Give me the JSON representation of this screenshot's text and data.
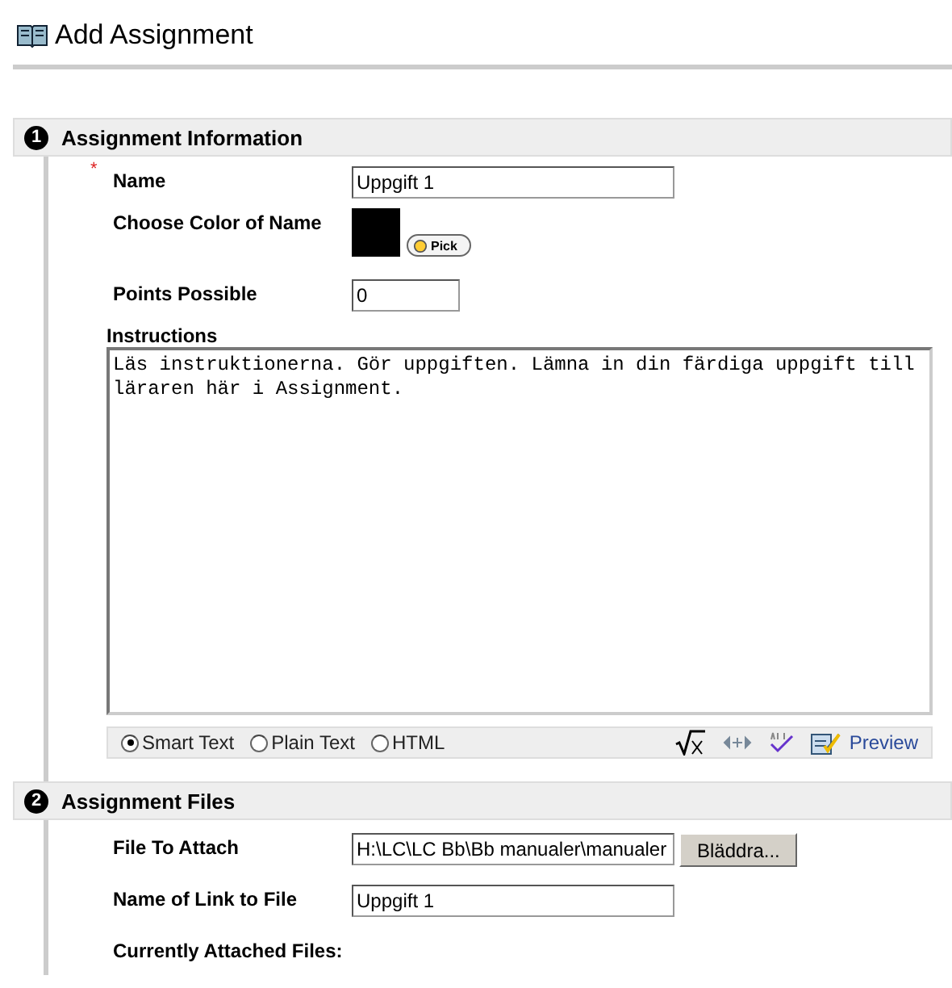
{
  "page": {
    "title": "Add Assignment"
  },
  "sections": [
    {
      "number": "1",
      "title": "Assignment Information"
    },
    {
      "number": "2",
      "title": "Assignment Files"
    }
  ],
  "info": {
    "name": {
      "label": "Name",
      "required": true,
      "required_mark": "*",
      "value": "Uppgift 1"
    },
    "color": {
      "label": "Choose Color of Name",
      "button": "Pick"
    },
    "points": {
      "label": "Points Possible",
      "value": "0"
    },
    "instructions": {
      "label": "Instructions",
      "value": "Läs instruktionerna. Gör uppgiften. Lämna in din färdiga uppgift till läraren här i Assignment.",
      "modes": [
        {
          "label": "Smart Text",
          "selected": true
        },
        {
          "label": "Plain Text",
          "selected": false
        },
        {
          "label": "HTML",
          "selected": false
        }
      ],
      "preview": "Preview"
    }
  },
  "files": {
    "file": {
      "label": "File To Attach",
      "value": "H:\\LC\\LC Bb\\Bb manualer\\manualer",
      "button": "Bläddra..."
    },
    "link_name": {
      "label": "Name of Link to File",
      "value": "Uppgift 1"
    },
    "attached": {
      "label": "Currently Attached Files:"
    }
  }
}
